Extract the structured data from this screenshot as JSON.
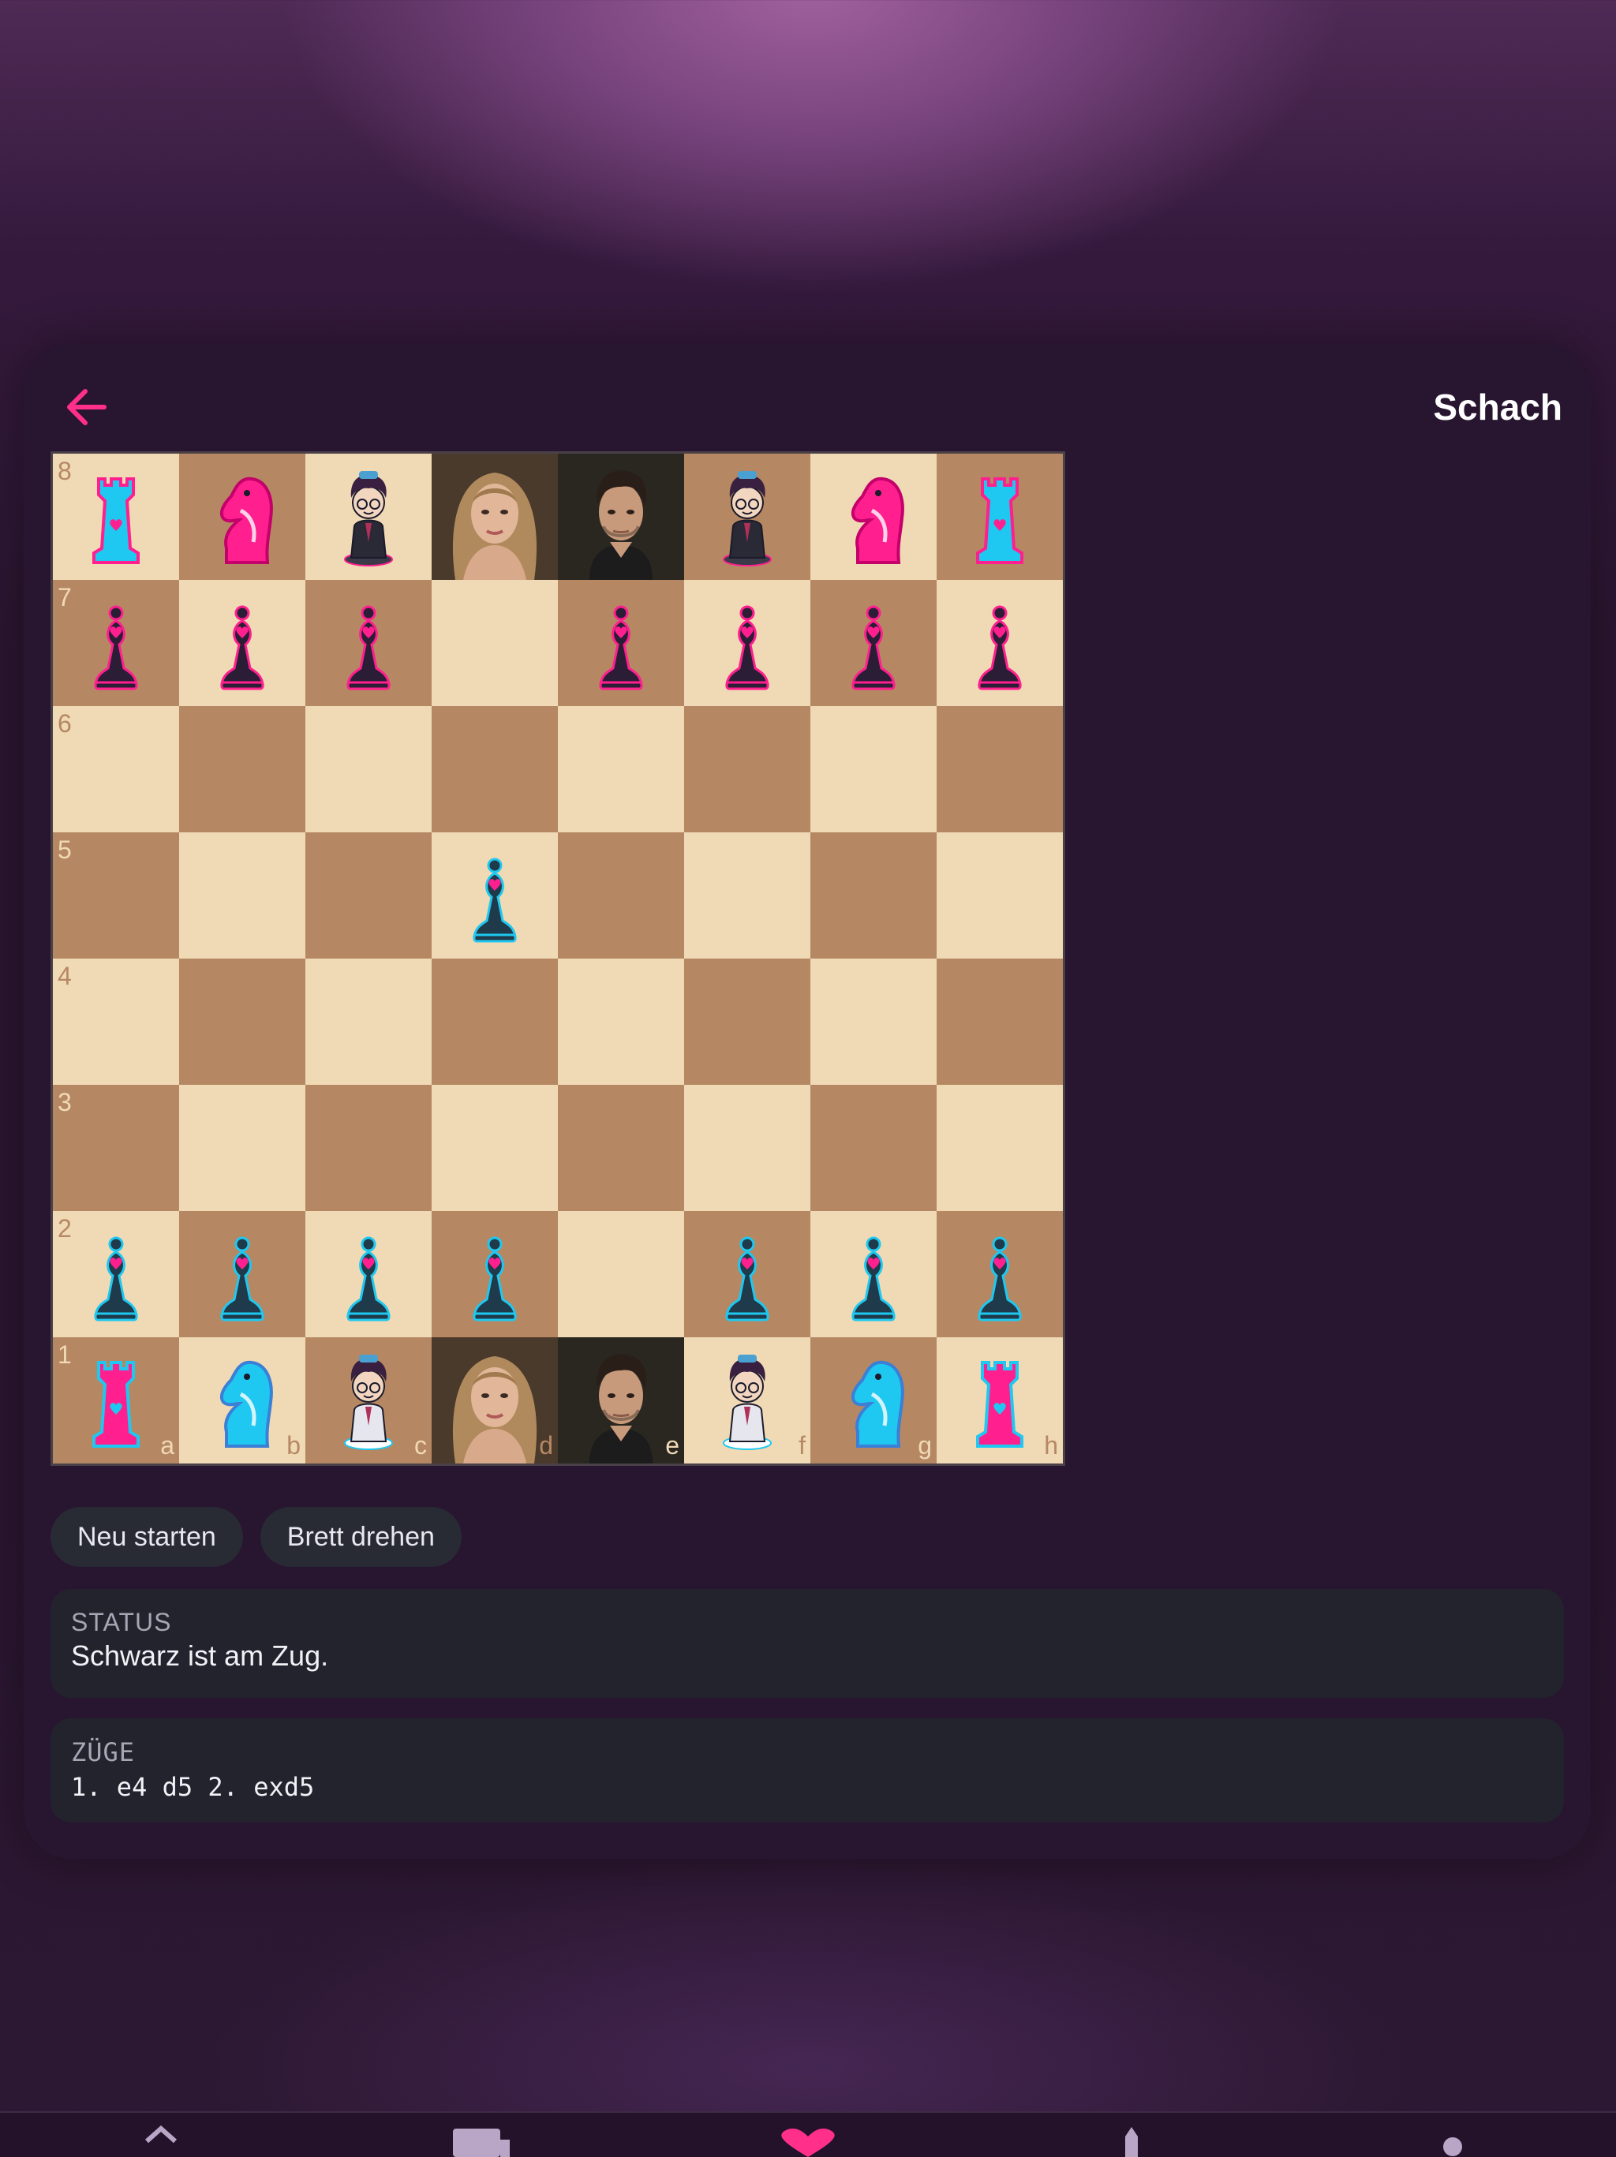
{
  "header": {
    "title": "Schach",
    "back_icon": "arrow-left-icon"
  },
  "colors": {
    "accent": "#ff2f8a",
    "light_square": "#f0d9b5",
    "dark_square": "#b58863",
    "white_pieces": "#1ec8f0",
    "black_pieces": "#ff1f8f",
    "card_bg": "#281530",
    "panel_bg": "#22232d"
  },
  "board": {
    "files": [
      "a",
      "b",
      "c",
      "d",
      "e",
      "f",
      "g",
      "h"
    ],
    "ranks": [
      "8",
      "7",
      "6",
      "5",
      "4",
      "3",
      "2",
      "1"
    ],
    "rows": [
      [
        "bR",
        "bN",
        "bB",
        "bQ",
        "bK",
        "bB",
        "bN",
        "bR"
      ],
      [
        "bP",
        "bP",
        "bP",
        "",
        "bP",
        "bP",
        "bP",
        "bP"
      ],
      [
        "",
        "",
        "",
        "",
        "",
        "",
        "",
        ""
      ],
      [
        "",
        "",
        "",
        "wP",
        "",
        "",
        "",
        ""
      ],
      [
        "",
        "",
        "",
        "",
        "",
        "",
        "",
        ""
      ],
      [
        "",
        "",
        "",
        "",
        "",
        "",
        "",
        ""
      ],
      [
        "wP",
        "wP",
        "wP",
        "wP",
        "",
        "wP",
        "wP",
        "wP"
      ],
      [
        "wR",
        "wN",
        "wB",
        "wQ",
        "wK",
        "wB",
        "wN",
        "wR"
      ]
    ]
  },
  "controls": {
    "restart_label": "Neu starten",
    "flip_label": "Brett drehen"
  },
  "status": {
    "label": "STATUS",
    "text": "Schwarz ist am Zug."
  },
  "moves": {
    "label": "ZÜGE",
    "text": "1. e4 d5 2. exd5"
  },
  "tabbar": {
    "icons": [
      "home-icon",
      "folder-icon",
      "heart-icon",
      "rocket-icon",
      "profile-icon"
    ]
  }
}
